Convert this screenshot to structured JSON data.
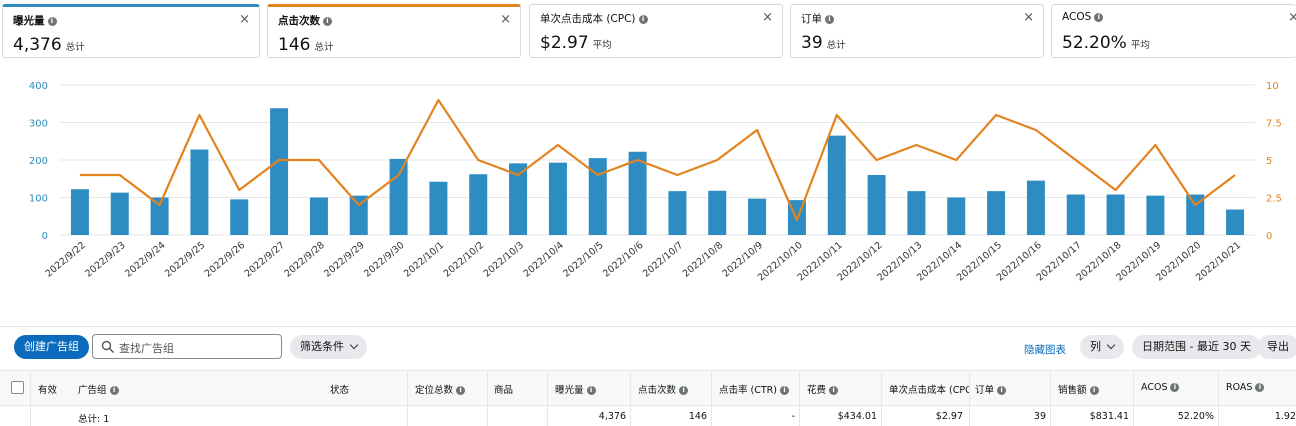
{
  "metrics": [
    {
      "title": "曝光量",
      "value": "4,376",
      "unit": "总计"
    },
    {
      "title": "点击次数",
      "value": "146",
      "unit": "总计"
    },
    {
      "title": "单次点击成本 (CPC)",
      "value": "$2.97",
      "unit": "平均"
    },
    {
      "title": "订单",
      "value": "39",
      "unit": "总计"
    },
    {
      "title": "ACOS",
      "value": "52.20%",
      "unit": "平均"
    }
  ],
  "close_icon": "×",
  "colors": {
    "impressions": "#2d8cc1",
    "clicks": "#e3831f",
    "link": "#0a6bbd",
    "primary": "#0a6bbd"
  },
  "chart_data": {
    "type": "bar+line",
    "categories": [
      "2022/9/22",
      "2022/9/23",
      "2022/9/24",
      "2022/9/25",
      "2022/9/26",
      "2022/9/27",
      "2022/9/28",
      "2022/9/29",
      "2022/9/30",
      "2022/10/1",
      "2022/10/2",
      "2022/10/3",
      "2022/10/4",
      "2022/10/5",
      "2022/10/6",
      "2022/10/7",
      "2022/10/8",
      "2022/10/9",
      "2022/10/10",
      "2022/10/11",
      "2022/10/12",
      "2022/10/13",
      "2022/10/14",
      "2022/10/15",
      "2022/10/16",
      "2022/10/17",
      "2022/10/18",
      "2022/10/19",
      "2022/10/20",
      "2022/10/21"
    ],
    "series": [
      {
        "type": "bar",
        "axis": "left",
        "color": "#2d8cc1",
        "values": [
          122,
          113,
          100,
          228,
          95,
          338,
          100,
          105,
          203,
          142,
          162,
          191,
          193,
          205,
          222,
          117,
          118,
          97,
          93,
          265,
          160,
          117,
          100,
          117,
          145,
          108,
          108,
          105,
          108,
          68
        ]
      },
      {
        "type": "line",
        "axis": "right",
        "color": "#e3831f",
        "values": [
          4,
          4,
          2,
          8,
          3,
          5,
          5,
          2,
          4,
          9,
          5,
          4,
          6,
          4,
          5,
          4,
          5,
          7,
          1,
          8,
          5,
          6,
          5,
          8,
          7,
          5,
          3,
          6,
          2,
          4
        ]
      }
    ],
    "y_left": {
      "min": 0,
      "max": 400,
      "ticks": [
        0,
        100,
        200,
        300,
        400
      ]
    },
    "y_right": {
      "min": 0,
      "max": 10,
      "ticks": [
        "0",
        "2.5",
        "5",
        "7.5",
        "10"
      ]
    },
    "grid": true
  },
  "toolbar": {
    "create_label": "创建广告组",
    "search_placeholder": "查找广告组",
    "filter_label": "筛选条件",
    "hide_chart_label": "隐藏图表",
    "columns_label": "列",
    "date_range_label": "日期范围 - 最近 30 天",
    "export_label": "导出"
  },
  "table": {
    "headers": [
      "有效",
      "广告组",
      "状态",
      "定位总数",
      "商品",
      "曝光量",
      "点击次数",
      "点击率 (CTR)",
      "花费",
      "单次点击成本 (CPC)",
      "订单",
      "销售额",
      "ACOS",
      "ROAS"
    ],
    "total_row": {
      "label": "总计: 1",
      "impressions": "4,376",
      "clicks": "146",
      "ctr": "-",
      "spend": "$434.01",
      "cpc": "$2.97",
      "orders": "39",
      "sales": "$831.41",
      "acos": "52.20%",
      "roas": "1.92"
    }
  }
}
